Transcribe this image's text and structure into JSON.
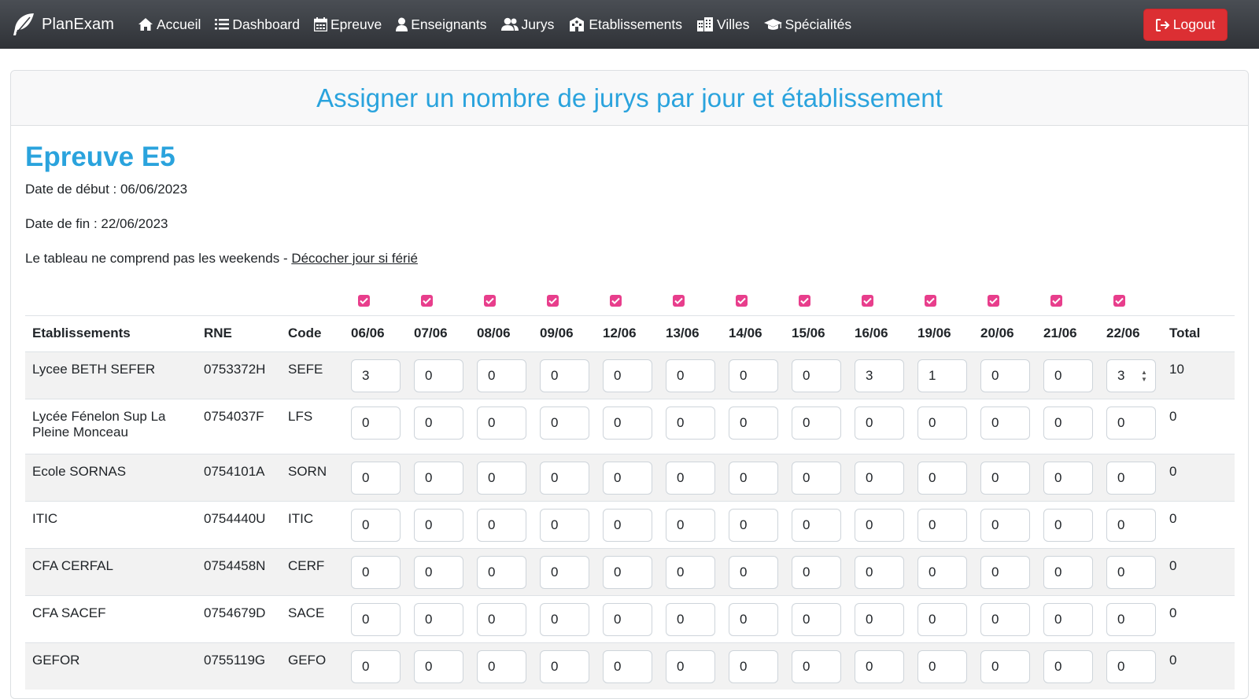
{
  "nav": {
    "brand": "PlanExam",
    "items": [
      {
        "label": "Accueil",
        "icon": "home-icon"
      },
      {
        "label": "Dashboard",
        "icon": "list-icon"
      },
      {
        "label": "Epreuve",
        "icon": "calendar-icon"
      },
      {
        "label": "Enseignants",
        "icon": "user-icon"
      },
      {
        "label": "Jurys",
        "icon": "users-icon"
      },
      {
        "label": "Etablissements",
        "icon": "school-icon"
      },
      {
        "label": "Villes",
        "icon": "city-icon"
      },
      {
        "label": "Spécialités",
        "icon": "graduation-cap-icon"
      }
    ],
    "logout": "Logout"
  },
  "card": {
    "title": "Assigner un nombre de jurys par jour et établissement"
  },
  "epreuve": {
    "title": "Epreuve E5",
    "start": "Date de début : 06/06/2023",
    "end": "Date de fin : 22/06/2023",
    "note": "Le tableau ne comprend pas les weekends - ",
    "link": "Décocher jour si férié"
  },
  "table": {
    "headers": [
      "Etablissements",
      "RNE",
      "Code"
    ],
    "days": [
      "06/06",
      "07/06",
      "08/06",
      "09/06",
      "12/06",
      "13/06",
      "14/06",
      "15/06",
      "16/06",
      "19/06",
      "20/06",
      "21/06",
      "22/06"
    ],
    "total_header": "Total",
    "rows": [
      {
        "name": "Lycee BETH SEFER",
        "rne": "0753372H",
        "code": "SEFE",
        "values": [
          "3",
          "0",
          "0",
          "0",
          "0",
          "0",
          "0",
          "0",
          "3",
          "1",
          "0",
          "0",
          "3"
        ],
        "total": "10"
      },
      {
        "name": "Lycée Fénelon Sup La Pleine Monceau",
        "rne": "0754037F",
        "code": "LFS",
        "values": [
          "0",
          "0",
          "0",
          "0",
          "0",
          "0",
          "0",
          "0",
          "0",
          "0",
          "0",
          "0",
          "0"
        ],
        "total": "0"
      },
      {
        "name": "Ecole SORNAS",
        "rne": "0754101A",
        "code": "SORN",
        "values": [
          "0",
          "0",
          "0",
          "0",
          "0",
          "0",
          "0",
          "0",
          "0",
          "0",
          "0",
          "0",
          "0"
        ],
        "total": "0"
      },
      {
        "name": "ITIC",
        "rne": "0754440U",
        "code": "ITIC",
        "values": [
          "0",
          "0",
          "0",
          "0",
          "0",
          "0",
          "0",
          "0",
          "0",
          "0",
          "0",
          "0",
          "0"
        ],
        "total": "0"
      },
      {
        "name": "CFA CERFAL",
        "rne": "0754458N",
        "code": "CERF",
        "values": [
          "0",
          "0",
          "0",
          "0",
          "0",
          "0",
          "0",
          "0",
          "0",
          "0",
          "0",
          "0",
          "0"
        ],
        "total": "0"
      },
      {
        "name": "CFA SACEF",
        "rne": "0754679D",
        "code": "SACE",
        "values": [
          "0",
          "0",
          "0",
          "0",
          "0",
          "0",
          "0",
          "0",
          "0",
          "0",
          "0",
          "0",
          "0"
        ],
        "total": "0"
      },
      {
        "name": "GEFOR",
        "rne": "0755119G",
        "code": "GEFO",
        "values": [
          "0",
          "0",
          "0",
          "0",
          "0",
          "0",
          "0",
          "0",
          "0",
          "0",
          "0",
          "0",
          "0"
        ],
        "total": "0"
      }
    ]
  },
  "colors": {
    "accent": "#2aa3dd",
    "checkbox": "#e83e8c",
    "logout": "#dc2f33",
    "navbar": "#3a3d42"
  }
}
